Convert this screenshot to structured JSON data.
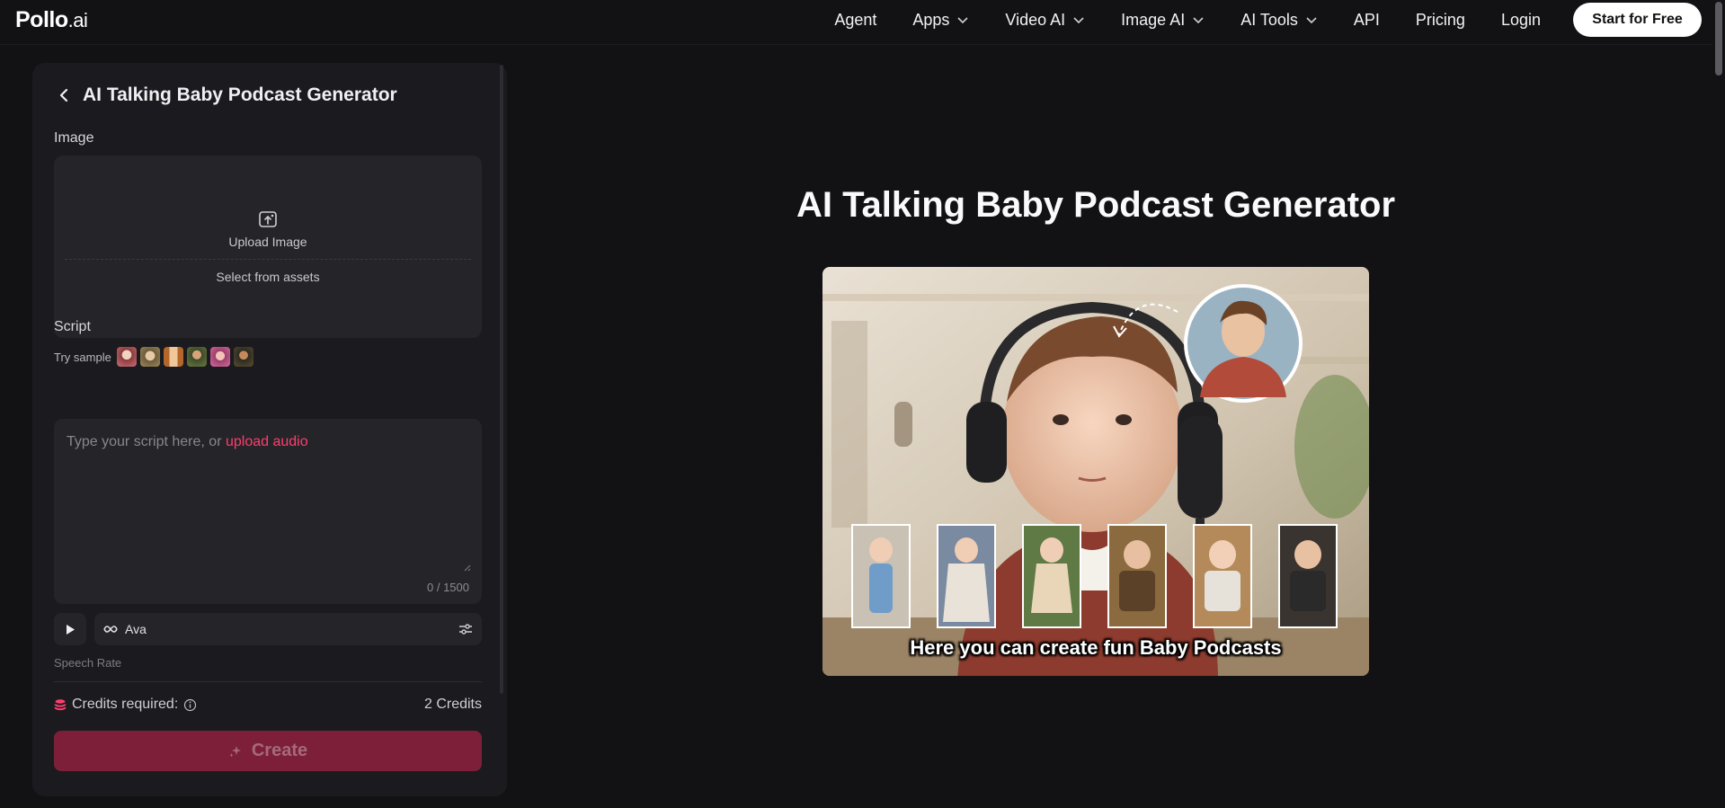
{
  "brand": {
    "logo_main": "Pollo",
    "logo_suffix": ".ai"
  },
  "nav": {
    "items": [
      {
        "label": "Agent",
        "dropdown": false
      },
      {
        "label": "Apps",
        "dropdown": true
      },
      {
        "label": "Video AI",
        "dropdown": true
      },
      {
        "label": "Image AI",
        "dropdown": true
      },
      {
        "label": "AI Tools",
        "dropdown": true
      },
      {
        "label": "API",
        "dropdown": false
      },
      {
        "label": "Pricing",
        "dropdown": false
      },
      {
        "label": "Login",
        "dropdown": false
      }
    ],
    "cta": "Start for Free"
  },
  "panel": {
    "title": "AI Talking Baby Podcast Generator",
    "image_label": "Image",
    "upload_label": "Upload Image",
    "assets_label": "Select from assets",
    "try_sample_label": "Try sample",
    "sample_count": 6,
    "script_label": "Script",
    "script_placeholder": "Type your script here, or ",
    "script_upload_link": "upload audio",
    "counter": "0 / 1500",
    "voice_name": "Ava",
    "speech_rate_label": "Speech Rate",
    "credits_label": "Credits required:",
    "credits_value": "2 Credits",
    "create_label": "Create"
  },
  "main": {
    "title": "AI Talking Baby Podcast Generator",
    "hero_caption": "Here you can create fun Baby Podcasts"
  },
  "colors": {
    "background": "#121215",
    "panel": "#1b1b1f",
    "input": "#252529",
    "accent": "#ff3d6e",
    "create_button": "#7e1f3a"
  }
}
